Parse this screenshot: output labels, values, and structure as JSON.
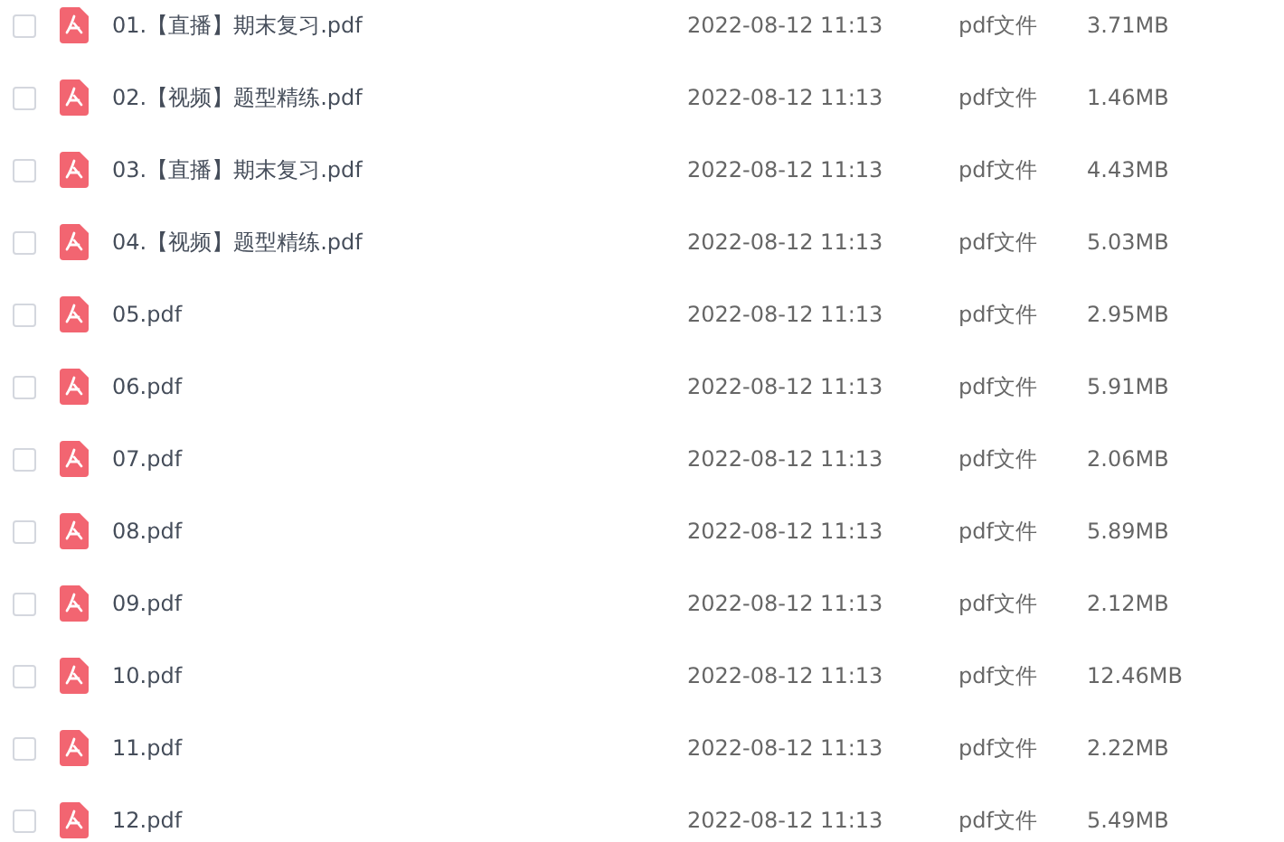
{
  "files": [
    {
      "name": "01.【直播】期末复习.pdf",
      "date": "2022-08-12 11:13",
      "type": "pdf文件",
      "size": "3.71MB",
      "checked": false
    },
    {
      "name": "02.【视频】题型精练.pdf",
      "date": "2022-08-12 11:13",
      "type": "pdf文件",
      "size": "1.46MB",
      "checked": false
    },
    {
      "name": "03.【直播】期末复习.pdf",
      "date": "2022-08-12 11:13",
      "type": "pdf文件",
      "size": "4.43MB",
      "checked": false
    },
    {
      "name": "04.【视频】题型精练.pdf",
      "date": "2022-08-12 11:13",
      "type": "pdf文件",
      "size": "5.03MB",
      "checked": false
    },
    {
      "name": "05.pdf",
      "date": "2022-08-12 11:13",
      "type": "pdf文件",
      "size": "2.95MB",
      "checked": false
    },
    {
      "name": "06.pdf",
      "date": "2022-08-12 11:13",
      "type": "pdf文件",
      "size": "5.91MB",
      "checked": false
    },
    {
      "name": "07.pdf",
      "date": "2022-08-12 11:13",
      "type": "pdf文件",
      "size": "2.06MB",
      "checked": false
    },
    {
      "name": "08.pdf",
      "date": "2022-08-12 11:13",
      "type": "pdf文件",
      "size": "5.89MB",
      "checked": false
    },
    {
      "name": "09.pdf",
      "date": "2022-08-12 11:13",
      "type": "pdf文件",
      "size": "2.12MB",
      "checked": false
    },
    {
      "name": "10.pdf",
      "date": "2022-08-12 11:13",
      "type": "pdf文件",
      "size": "12.46MB",
      "checked": false
    },
    {
      "name": "11.pdf",
      "date": "2022-08-12 11:13",
      "type": "pdf文件",
      "size": "2.22MB",
      "checked": false
    },
    {
      "name": "12.pdf",
      "date": "2022-08-12 11:13",
      "type": "pdf文件",
      "size": "5.49MB",
      "checked": false
    }
  ]
}
